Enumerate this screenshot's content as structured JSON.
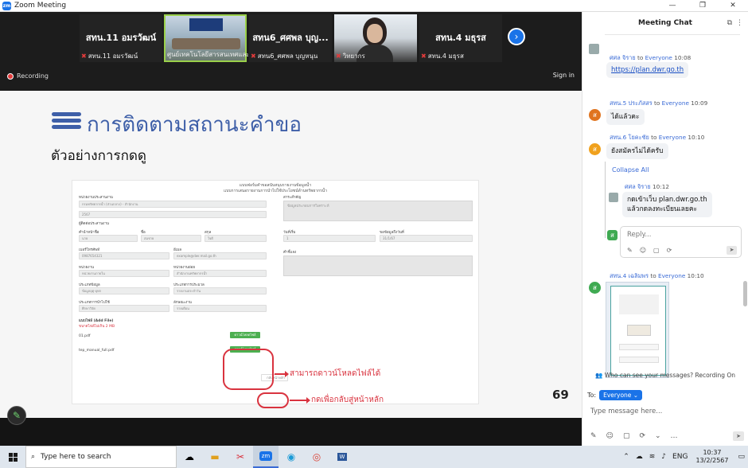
{
  "window": {
    "app_title": "Zoom Meeting",
    "logo_text": "zm",
    "minimize": "—",
    "maximize": "❐",
    "close": "✕"
  },
  "participants": [
    {
      "name_display": "สทน.11 อมรวัฒน์",
      "label": "สทน.11 อมรวัฒน์",
      "muted": true
    },
    {
      "name_display": "",
      "label": "ศูนย์เทคโนโลยีสารสนเทศและการ...",
      "muted": false
    },
    {
      "name_display": "สทน6_ศศพล บุญ...",
      "label": "สทน6_ศศพล บุญหนุน",
      "muted": true
    },
    {
      "name_display": "",
      "label": "วิทยากร",
      "muted": true
    },
    {
      "name_display": "สทน.4 มธุรส",
      "label": "สทน.4 มธุรส",
      "muted": true
    }
  ],
  "next_icon": "next-arrow-icon",
  "recording": {
    "label": "Recording"
  },
  "signin": "Sign in",
  "slide": {
    "title": "การติดตามสถานะคำขอ",
    "subtitle": "ตัวอย่างการกดดู",
    "page_number": "69",
    "form_header_line1": "แบบฟอร์มคำขอสนับสนุนรายงานข้อมูลน้ำ",
    "form_header_line2": "แบบการเสนอรายงานการนำไปใช้ประโยชน์ด้านทรัพยากรน้ำ",
    "form_labels": {
      "agency": "หน่วยงานประสานงาน",
      "contact": "ผู้ติดต่อประสานงาน",
      "prefix": "คำนำหน้าชื่อ",
      "name": "ชื่อ",
      "surname": "สกุล",
      "phone": "เบอร์โทรศัพท์",
      "email": "อีเมล",
      "dept": "หน่วยงาน",
      "subdept": "หน่วยงานย่อย",
      "datatype": "ประเภทข้อมูล",
      "datasub": "ประเภทการประมวล",
      "usage": "ประเภทการนำไปใช้",
      "period": "ลักษณะงาน",
      "attach": "แนบไฟล์ (Add File)",
      "attach_note": "ขนาดไฟล์ไม่เกิน 2 MB",
      "file1": "01.pdf",
      "file2": "tep_manual_full.pdf",
      "purpose": "สาระสำคัญ",
      "start": "วันที่เริ่ม",
      "end": "ขอข้อมูลถึงวันที่",
      "note": "คำชี้แจง"
    },
    "form_values": {
      "agency_value": "กรมทรัพยากรน้ำ (ส่วนกลาง) - สำนักงาน",
      "year_value": "2567",
      "prefix_value": "นาย",
      "name_value": "สมชาย",
      "surname_value": "ใจดี",
      "phone_value": "0987654321",
      "email_value": "example@dwr.mail.go.th",
      "dept_value": "หน่วยงานภายใน",
      "subdept_value": "สำนักงานทรัพยากรน้ำ",
      "datatype_value": "ข้อมูลอุตุ-อุทก",
      "datasub_value": "รายงานประจำวัน",
      "usage_value": "ศึกษาวิจัย",
      "period_value": "รายเดือน",
      "purpose_value": "ข้อมูลประกอบการวิเคราะห์",
      "start_value": "1",
      "end_value": "31/1/67"
    },
    "download_btn_1": "ดาวน์โหลดไฟล์",
    "download_btn_2": "ดาวน์โหลดไฟล์",
    "back_btn": "กลับหน้าหลัก",
    "annotation_download": "สามารถดาวน์โหลดไฟล์ได้",
    "annotation_back": "กดเพื่อกลับสู่หน้าหลัก"
  },
  "chat": {
    "title": "Meeting Chat",
    "header_icons": [
      "popout-icon",
      "more-icon"
    ],
    "messages": [
      {
        "sender": "ศศล จิราย",
        "to_label": "to",
        "recipient": "Everyone",
        "time": "10:08",
        "text": "https://plan.dwr.go.th",
        "avatar": ""
      },
      {
        "sender": "สทน.5 ประภัสสร",
        "to_label": "to",
        "recipient": "Everyone",
        "time": "10:09",
        "text": "ได้แล้วคะ",
        "avatar": "ส"
      },
      {
        "sender": "สทน.6 โยคะชัย",
        "to_label": "to",
        "recipient": "Everyone",
        "time": "10:10",
        "text": "ยังสมัครไม่ได้ครับ",
        "avatar": "ส"
      }
    ],
    "collapse_label": "Collapse All",
    "thread_reply": {
      "sender": "ศศล จิราย",
      "time": "10:12",
      "line1": "กดเข้าเว็บ plan.dwr.go.th",
      "line2": "แล้วกดลงทะเบียนเลยคะ"
    },
    "reply_placeholder": "Reply...",
    "reply_avatar": "ส",
    "last_message": {
      "sender": "สทน.4 เฉลิมพร",
      "to_label": "to",
      "recipient": "Everyone",
      "time": "10:10",
      "avatar": "ส"
    },
    "who_can_see": "Who can see your messages? Recording On",
    "to_prefix": "To:",
    "to_value": "Everyone",
    "type_placeholder": "Type message here..."
  },
  "taskbar": {
    "search_placeholder": "Type here to search",
    "apps": [
      "weather-icon",
      "file-explorer-icon",
      "snipping-tool-icon",
      "zoom-icon",
      "edge-icon",
      "chrome-icon",
      "word-icon"
    ],
    "lang": "ENG",
    "time": "10:37",
    "date": "13/2/2567"
  },
  "colors": {
    "zoom_blue": "#1a73e8",
    "slide_title": "#3e5fa8",
    "annotation_red": "#d9333f",
    "download_green": "#4caf50"
  }
}
